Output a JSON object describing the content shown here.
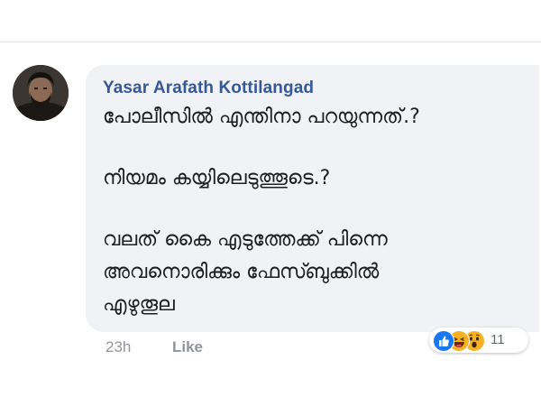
{
  "comment": {
    "author": "Yasar Arafath Kottilangad",
    "lines": [
      "പോലീസിൽ എന്തിനാ പറയുന്നത്.?",
      "നിയമം കയ്യിലെടുത്തൂടെ.?",
      "വലത് കൈ എടുത്തേക്ക് പിന്നെ",
      "അവനൊരിക്കും ഫേസ്ബുക്കിൽ",
      "എഴുതൂല"
    ],
    "time": "23h",
    "like_label": "Like",
    "reactions": {
      "icons": [
        "like-reaction-icon",
        "haha-reaction-icon",
        "wow-reaction-icon"
      ],
      "count": "11"
    }
  },
  "colors": {
    "author": "#365899",
    "bubble": "#f0f2f5",
    "like_blue": "#1877f2",
    "emoji_yellow": "#f7b125"
  }
}
